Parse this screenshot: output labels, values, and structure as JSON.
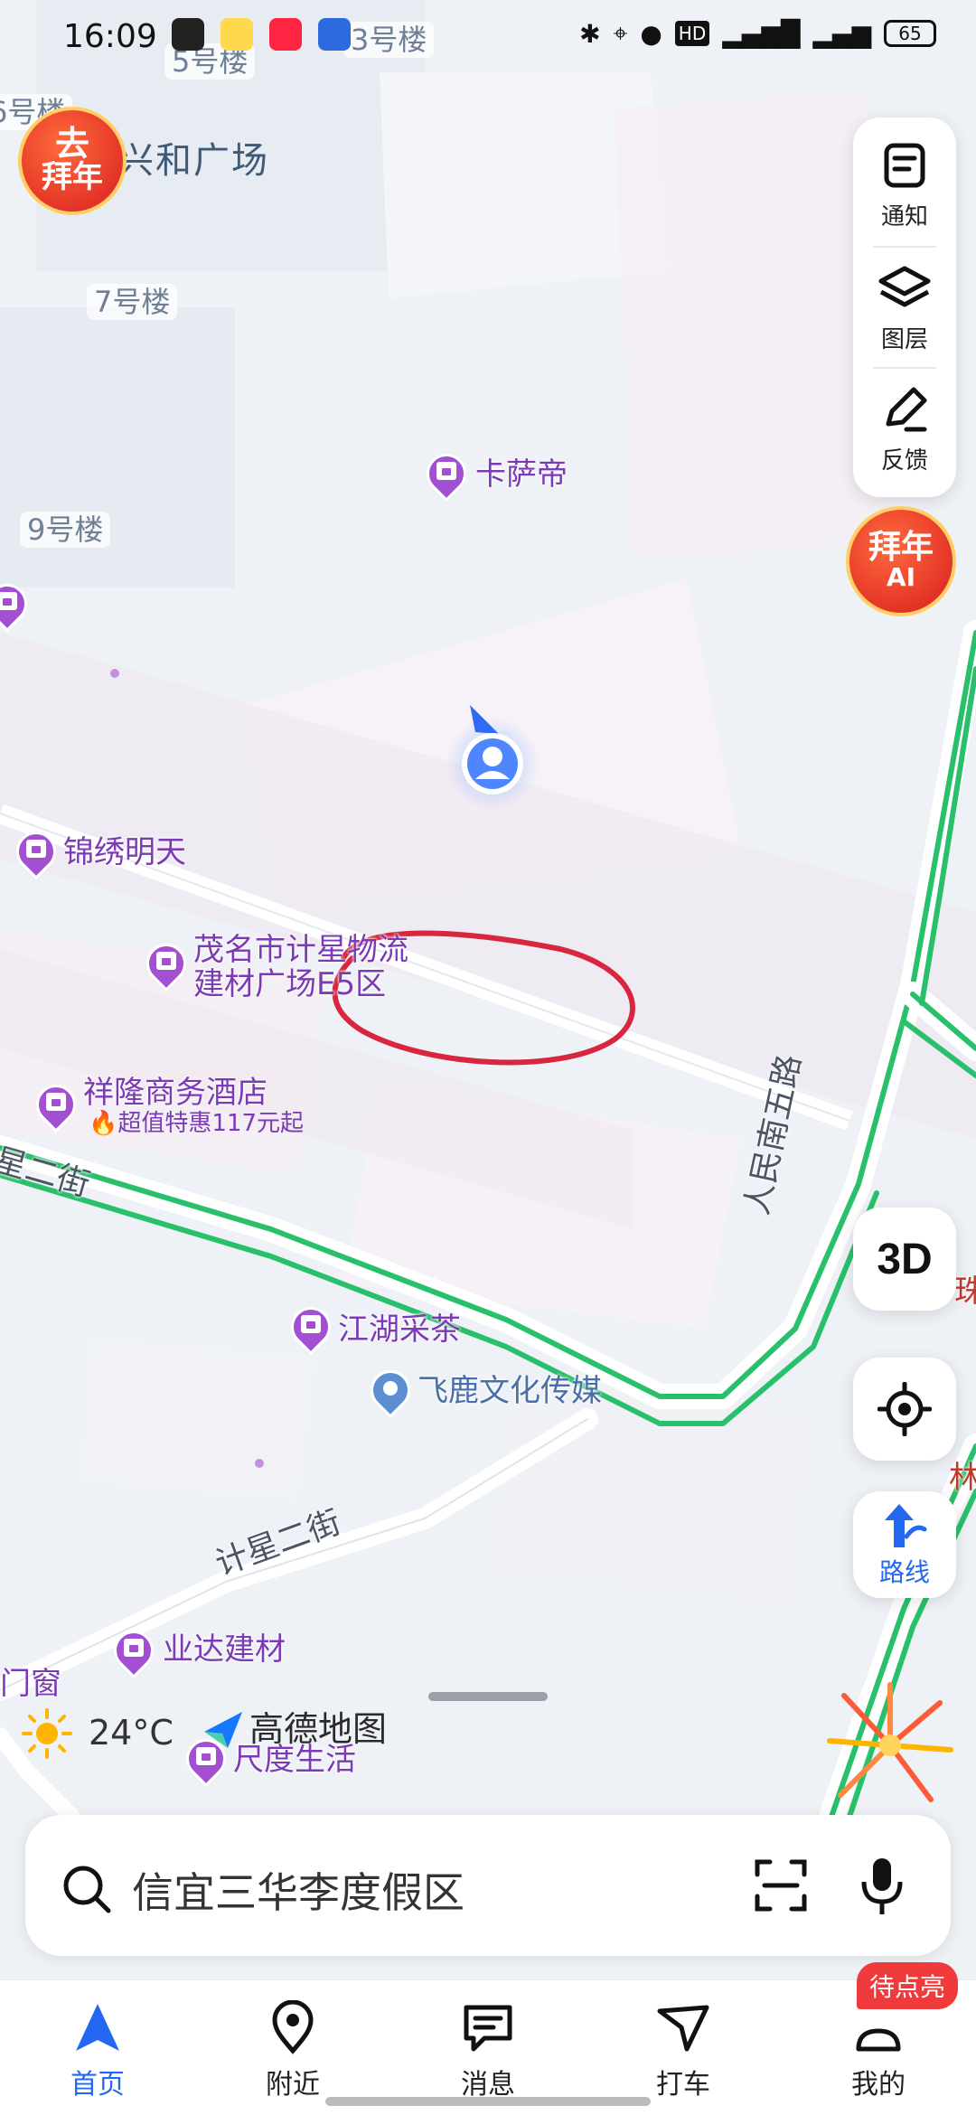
{
  "status_bar": {
    "time": "16:09",
    "battery": "65",
    "icons": [
      "listen-app-icon",
      "xiaohongshu-icon",
      "baidu-icon",
      "bluetooth-icon",
      "location-icon",
      "mic-icon",
      "hd-icon",
      "signal-4g-icon",
      "signal-4g-icon"
    ]
  },
  "map": {
    "building_labels": [
      "5号楼",
      "6号楼",
      "7号楼",
      "9号楼",
      "3号楼"
    ],
    "area_label": "兴和广场",
    "pois": [
      {
        "name": "卡萨帝",
        "type": "store"
      },
      {
        "name": "锦绣明天",
        "type": "store"
      },
      {
        "name": "茂名市计星物流",
        "name2": "建材广场E5区",
        "type": "store"
      },
      {
        "name": "祥隆商务酒店",
        "type": "hotel",
        "promo": "超值特惠117元起"
      },
      {
        "name": "江湖采茶",
        "type": "store"
      },
      {
        "name": "飞鹿文化传媒",
        "type": "company"
      },
      {
        "name": "业达建材",
        "type": "store"
      },
      {
        "name": "尺度生活",
        "type": "store"
      },
      {
        "name": "门窗",
        "type": "store"
      },
      {
        "name": "珠",
        "type": "store"
      },
      {
        "name": "林",
        "type": "store"
      }
    ],
    "roads": [
      "星二街",
      "人民南五路",
      "计星二街"
    ],
    "weather": {
      "temp": "24°C"
    },
    "brand": "高德地图",
    "colors": {
      "road_green": "#29c06b",
      "poi_purple": "#a34fd1",
      "annotation_red": "#d7263d",
      "accent_blue": "#2468f2"
    }
  },
  "badges": {
    "top_left": {
      "line1": "去",
      "line2": "拜年"
    },
    "right": {
      "line1": "拜年",
      "line2": "AI"
    }
  },
  "controls": {
    "notify": "通知",
    "layers": "图层",
    "feedback": "反馈",
    "view3d": "3D",
    "route": "路线"
  },
  "search": {
    "placeholder": "信宜三华李度假区"
  },
  "tabs": [
    {
      "label": "首页",
      "icon": "navigation-arrow-icon",
      "active": true
    },
    {
      "label": "附近",
      "icon": "location-pin-icon",
      "active": false
    },
    {
      "label": "消息",
      "icon": "message-icon",
      "active": false
    },
    {
      "label": "打车",
      "icon": "taxi-icon",
      "active": false
    },
    {
      "label": "我的",
      "icon": "profile-icon",
      "active": false,
      "badge": "待点亮"
    }
  ]
}
